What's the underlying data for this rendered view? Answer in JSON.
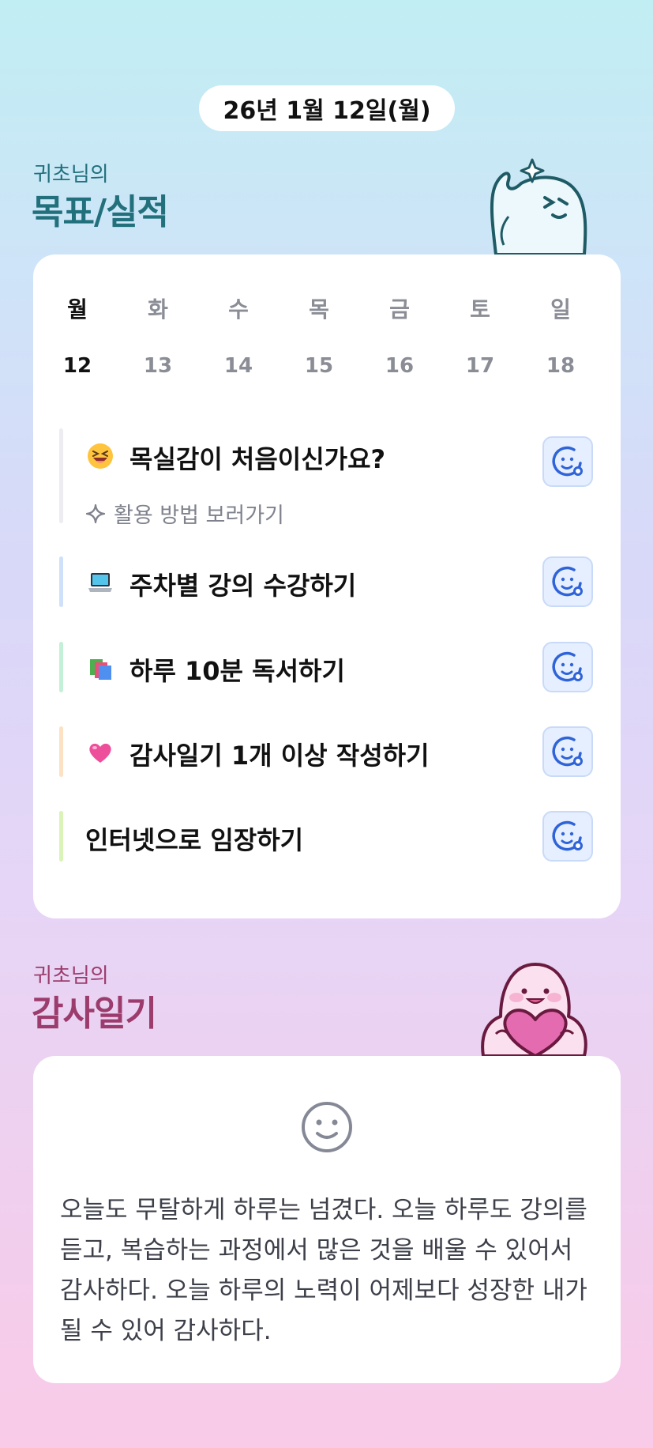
{
  "header": {
    "date": "26년 1월 12일(월)"
  },
  "goals_section": {
    "subtitle": "귀초님의",
    "title": "목표/실적"
  },
  "week": {
    "days": [
      "월",
      "화",
      "수",
      "목",
      "금",
      "토",
      "일"
    ],
    "dates": [
      "12",
      "13",
      "14",
      "15",
      "16",
      "17",
      "18"
    ],
    "selected_index": 0
  },
  "goals": [
    {
      "title": "목실감이 처음이신가요?",
      "emoji": "laughing-face-icon",
      "bar_color": "#ececf1",
      "guide": "활용 방법 보러가기"
    },
    {
      "title": "주차별 강의 수강하기",
      "emoji": "laptop-icon",
      "bar_color": "#cfe0fb"
    },
    {
      "title": "하루 10분 독서하기",
      "emoji": "books-icon",
      "bar_color": "#c4f0d8"
    },
    {
      "title": "감사일기 1개 이상 작성하기",
      "emoji": "pink-heart-icon",
      "bar_color": "#fde1c4"
    },
    {
      "title": "인터넷으로 임장하기",
      "emoji": "",
      "bar_color": "#d9f3b8"
    }
  ],
  "diary_section": {
    "subtitle": "귀초님의",
    "title": "감사일기"
  },
  "diary": {
    "icon": "smile-face-icon",
    "text": "오늘도 무탈하게 하루는 넘겼다. 오늘 하루도 강의를 듣고, 복습하는 과정에서 많은 것을 배울 수 있어서 감사하다. 오늘 하루의 노력이 어제보다 성장한 내가 될 수 있어 감사하다."
  },
  "colors": {
    "teal": "#21707c",
    "plum": "#9c3c6d",
    "button_blue": "#2f63d8"
  }
}
